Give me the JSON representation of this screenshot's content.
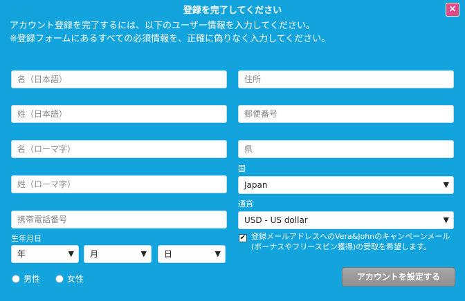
{
  "modal": {
    "title": "登録を完了してください",
    "close_label": "×",
    "intro_lines": [
      "アカウント登録を完了するには、以下のユーザー情報を入力してください。",
      "※登録フォームにあるすべての必須情報を、正確に偽りなく入力してください。"
    ]
  },
  "left_fields": [
    {
      "placeholder": "名（日本語）"
    },
    {
      "placeholder": "姓（日本語）"
    },
    {
      "placeholder": "名（ローマ字）"
    },
    {
      "placeholder": "姓（ローマ字）"
    },
    {
      "placeholder": "携帯電話番号"
    }
  ],
  "right_fields": [
    {
      "placeholder": "住所"
    },
    {
      "placeholder": "郵便番号"
    },
    {
      "placeholder": "県"
    }
  ],
  "country": {
    "label": "国",
    "value": "Japan"
  },
  "currency": {
    "label": "通貨",
    "value": "USD - US dollar"
  },
  "birthdate": {
    "label": "生年月日",
    "year": "年",
    "month": "月",
    "day": "日"
  },
  "gender": {
    "male": "男性",
    "female": "女性"
  },
  "newsletter": {
    "checked": true,
    "check_symbol": "✔",
    "text": "登録メールアドレスへのVera&Johnのキャンペーンメール(ボーナスやフリースピン獲得)の受取を希望します。"
  },
  "submit_label": "アカウントを設定する",
  "icons": {
    "dropdown": "▼"
  }
}
